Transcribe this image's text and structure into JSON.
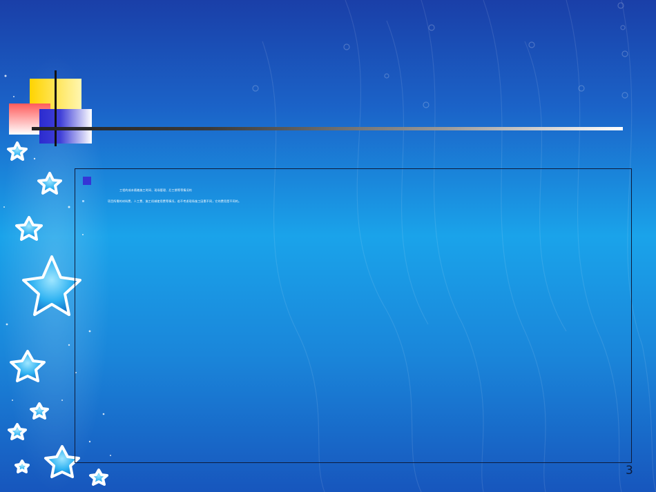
{
  "slide": {
    "body_lines": [
      "工程的成本随着施工时间、现场管理、后工期等等情况的",
      "项目所需的材料费、人工费、施工机械使用费等情况，若不考虑现场施工因素不同，它的费用是不同的。"
    ],
    "page_number": "3"
  },
  "colors": {
    "accent_yellow": "#ffd400",
    "accent_red": "#ff5b5b",
    "accent_blue": "#3535d6",
    "background_top": "#1a3fa8",
    "background_mid": "#1aa3ea"
  }
}
